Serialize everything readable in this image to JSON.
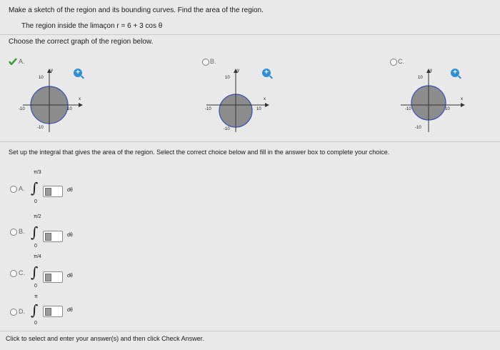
{
  "question": {
    "line1": "Make a sketch of the region and its bounding curves. Find the area of the region.",
    "line2": "The region inside the limaçon r = 6 + 3 cos θ",
    "line3": "Choose the correct graph of the region below."
  },
  "graph_options": [
    {
      "label": "A.",
      "ticks": {
        "y_top": "10",
        "x_left": "-10",
        "x_right": "10",
        "y_bottom": "-10",
        "y_axis": "y",
        "x_axis": "x"
      }
    },
    {
      "label": "B.",
      "ticks": {
        "y_top": "10",
        "x_left": "-10",
        "x_right": "10",
        "y_bottom": "-10",
        "y_axis": "y",
        "x_axis": "x"
      }
    },
    {
      "label": "C.",
      "ticks": {
        "y_top": "10",
        "x_left": "-10",
        "x_right": "10",
        "y_bottom": "-10",
        "y_axis": "y",
        "x_axis": "x"
      }
    }
  ],
  "zoom_icon": "+",
  "setup_text": "Set up the integral that gives the area of the region. Select the correct choice below and fill in the answer box to complete your choice.",
  "integral_options": [
    {
      "label": "A.",
      "upper": "π/3",
      "lower": "0",
      "dtheta": "dθ"
    },
    {
      "label": "B.",
      "upper": "π/2",
      "lower": "0",
      "dtheta": "dθ"
    },
    {
      "label": "C.",
      "upper": "π/4",
      "lower": "0",
      "dtheta": "dθ"
    },
    {
      "label": "D.",
      "upper": "π",
      "lower": "0",
      "dtheta": "dθ"
    }
  ],
  "footer": "Click to select and enter your answer(s) and then click Check Answer.",
  "colors": {
    "region_fill": "#8c8c8c",
    "curve": "#3b4fb0",
    "correct_check": "#3a9a3a"
  }
}
